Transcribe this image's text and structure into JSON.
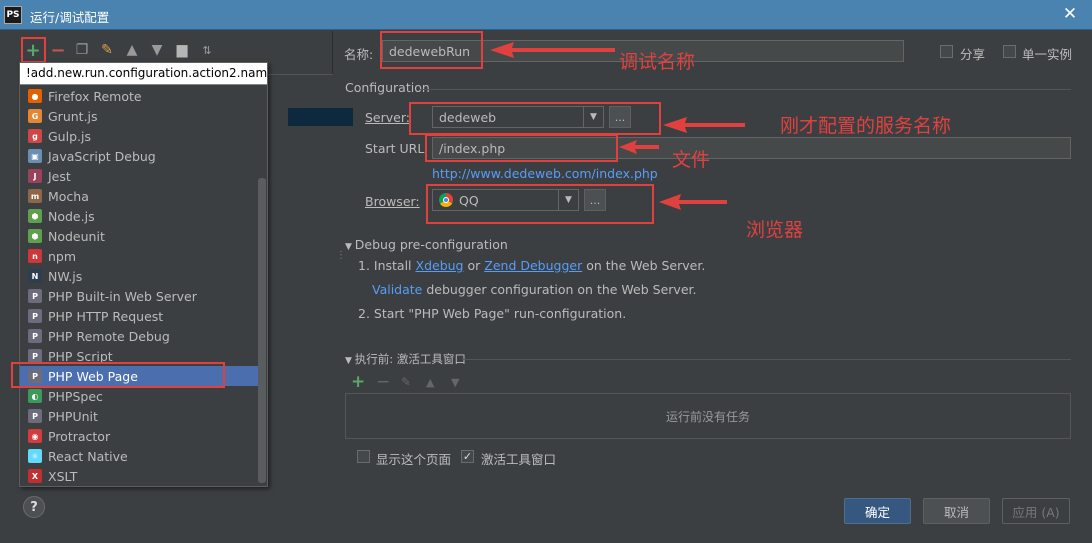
{
  "window": {
    "title": "运行/调试配置",
    "app_icon": "PS"
  },
  "toolbar": {
    "add": "+",
    "remove": "−"
  },
  "popup": {
    "header": "!add.new.run.configuration.action2.name!",
    "items": [
      {
        "label": "Firefox Remote",
        "icon": "firefox-icon",
        "color": "#e66000",
        "glyph": "●"
      },
      {
        "label": "Grunt.js",
        "icon": "grunt-icon",
        "color": "#e48632",
        "glyph": "G"
      },
      {
        "label": "Gulp.js",
        "icon": "gulp-icon",
        "color": "#cf4647",
        "glyph": "g"
      },
      {
        "label": "JavaScript Debug",
        "icon": "js-debug-icon",
        "color": "#6b8fb3",
        "glyph": "▣"
      },
      {
        "label": "Jest",
        "icon": "jest-icon",
        "color": "#99425b",
        "glyph": "J"
      },
      {
        "label": "Mocha",
        "icon": "mocha-icon",
        "color": "#8d6748",
        "glyph": "m"
      },
      {
        "label": "Node.js",
        "icon": "nodejs-icon",
        "color": "#5fa04e",
        "glyph": "⬢"
      },
      {
        "label": "Nodeunit",
        "icon": "nodeunit-icon",
        "color": "#5fa04e",
        "glyph": "⬢"
      },
      {
        "label": "npm",
        "icon": "npm-icon",
        "color": "#cb3837",
        "glyph": "n"
      },
      {
        "label": "NW.js",
        "icon": "nwjs-icon",
        "color": "#2c3e50",
        "glyph": "N"
      },
      {
        "label": "PHP Built-in Web Server",
        "icon": "php-server-icon",
        "color": "#6c6c7c",
        "glyph": "P"
      },
      {
        "label": "PHP HTTP Request",
        "icon": "php-http-icon",
        "color": "#6c6c7c",
        "glyph": "P"
      },
      {
        "label": "PHP Remote Debug",
        "icon": "php-remote-icon",
        "color": "#6c6c7c",
        "glyph": "P"
      },
      {
        "label": "PHP Script",
        "icon": "php-script-icon",
        "color": "#6c6c7c",
        "glyph": "P"
      },
      {
        "label": "PHP Web Page",
        "icon": "php-webpage-icon",
        "color": "#6c6c7c",
        "glyph": "P",
        "selected": true
      },
      {
        "label": "PHPSpec",
        "icon": "phpspec-icon",
        "color": "#3b9a5a",
        "glyph": "◐"
      },
      {
        "label": "PHPUnit",
        "icon": "phpunit-icon",
        "color": "#6c6c7c",
        "glyph": "P"
      },
      {
        "label": "Protractor",
        "icon": "protractor-icon",
        "color": "#d33c3c",
        "glyph": "◉"
      },
      {
        "label": "React Native",
        "icon": "react-icon",
        "color": "#61dafb",
        "glyph": "⚛"
      },
      {
        "label": "XSLT",
        "icon": "xslt-icon",
        "color": "#c03030",
        "glyph": "X"
      }
    ]
  },
  "form": {
    "name_label": "名称:",
    "name_value": "dedewebRun",
    "share_label": "分享",
    "single_label": "单一实例",
    "config_section": "Configuration",
    "server_label": "Server:",
    "server_value": "dedeweb",
    "starturl_label": "Start URL:",
    "starturl_value": "/index.php",
    "url_preview": "http://www.dedeweb.com/index.php",
    "browser_label": "Browser:",
    "browser_value": "QQ",
    "dots": "..."
  },
  "debug": {
    "section": "Debug pre-configuration",
    "step1_prefix": "1. Install",
    "xdebug": "Xdebug",
    "or": "or",
    "zend": "Zend Debugger",
    "step1_suffix": "on the Web Server.",
    "validate": "Validate",
    "validate_suffix": "debugger configuration on the Web Server.",
    "step2": "2. Start \"PHP Web Page\" run-configuration."
  },
  "before_launch": {
    "section": "执行前: 激活工具窗口",
    "empty": "运行前没有任务",
    "show_page": "显示这个页面",
    "activate_tool": "激活工具窗口"
  },
  "buttons": {
    "ok": "确定",
    "cancel": "取消",
    "apply": "应用 (A)",
    "help": "?"
  },
  "annotations": {
    "debug_name": "调试名称",
    "server_name": "刚才配置的服务名称",
    "file": "文件",
    "browser": "浏览器"
  },
  "colors": {
    "annotation": "#e0413f",
    "link": "#589df6",
    "selection": "#4b6eaf"
  }
}
